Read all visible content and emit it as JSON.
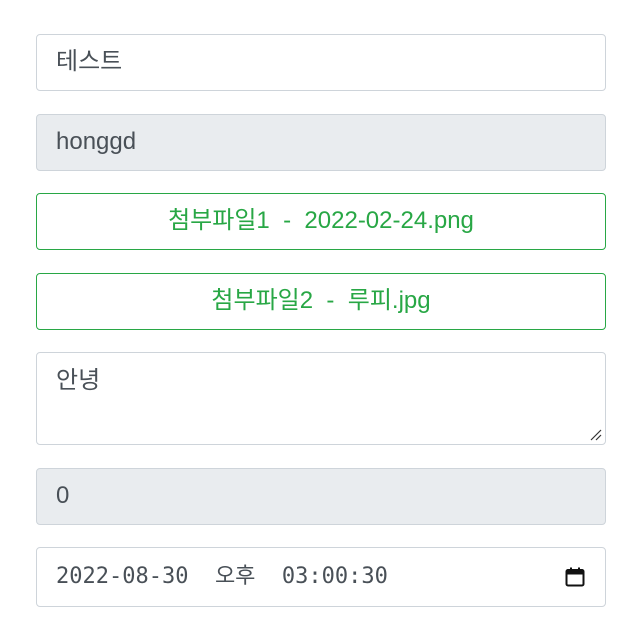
{
  "title_field": {
    "value": "테스트"
  },
  "writer_field": {
    "value": "honggd"
  },
  "attachments": [
    {
      "label": "첨부파일1  -  2022-02-24.png"
    },
    {
      "label": "첨부파일2  -  루피.jpg"
    }
  ],
  "content_field": {
    "value": "안녕"
  },
  "read_count_field": {
    "value": "0"
  },
  "date_field": {
    "value": "2022-08-30  오후  03:00:30",
    "icon": "calendar-icon"
  },
  "colors": {
    "attachment_accent": "#28a745",
    "readonly_bg": "#e9ecef",
    "border": "#ced4da",
    "text": "#495057"
  }
}
